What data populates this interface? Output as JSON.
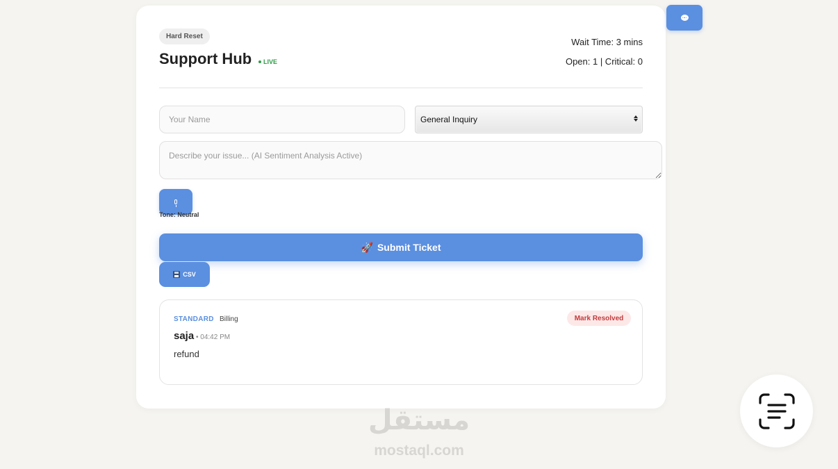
{
  "header": {
    "reset_label": "Hard Reset",
    "title": "Support Hub",
    "live_label": "LIVE",
    "wait_time": "Wait Time: 3 mins",
    "counts": "Open: 1 | Critical: 0"
  },
  "form": {
    "name_placeholder": "Your Name",
    "category_selected": "General Inquiry",
    "issue_placeholder": "Describe your issue... (AI Sentiment Analysis Active)",
    "tone_label": "Tone: Neutral",
    "submit_icon": "🚀",
    "submit_label": "Submit Ticket",
    "csv_label": "CSV"
  },
  "tickets": [
    {
      "priority": "STANDARD",
      "category": "Billing",
      "name": "saja",
      "time": "• 04:42 PM",
      "body": "refund",
      "action_label": "Mark Resolved"
    }
  ],
  "watermark": {
    "arabic": "مستقل",
    "latin": "mostaql.com"
  },
  "colors": {
    "accent": "#5b8fe0",
    "live": "#2e9e48",
    "danger": "#c23b3b",
    "background": "#f5f4f0"
  },
  "icons": {
    "chat": "chat-bubble-icon",
    "mic": "microphone-icon",
    "save": "floppy-disk-icon",
    "scan": "text-scan-icon"
  }
}
